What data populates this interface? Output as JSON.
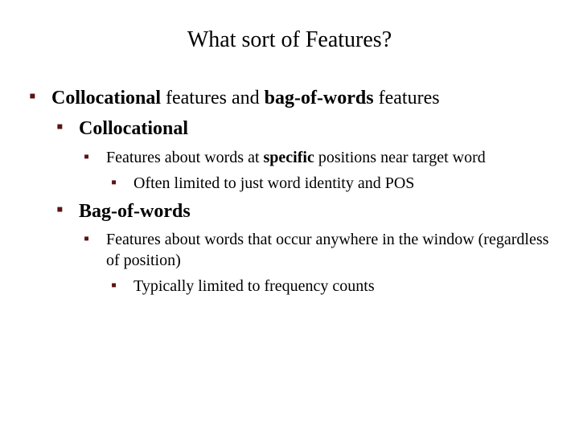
{
  "title": "What sort of Features?",
  "bullets": {
    "l1": {
      "pre": "Collocational",
      "mid": " features and ",
      "post": "bag-of-words",
      "tail": " features"
    },
    "colloc": {
      "head": "Collocational",
      "feat_pre": "Features about words at ",
      "feat_bold": "specific",
      "feat_post": " positions near target word",
      "sub": "Often limited to just word identity and POS"
    },
    "bow": {
      "head": "Bag-of-words",
      "feat": "Features about words that occur anywhere in the window (regardless of position)",
      "sub": "Typically limited to frequency counts"
    }
  }
}
